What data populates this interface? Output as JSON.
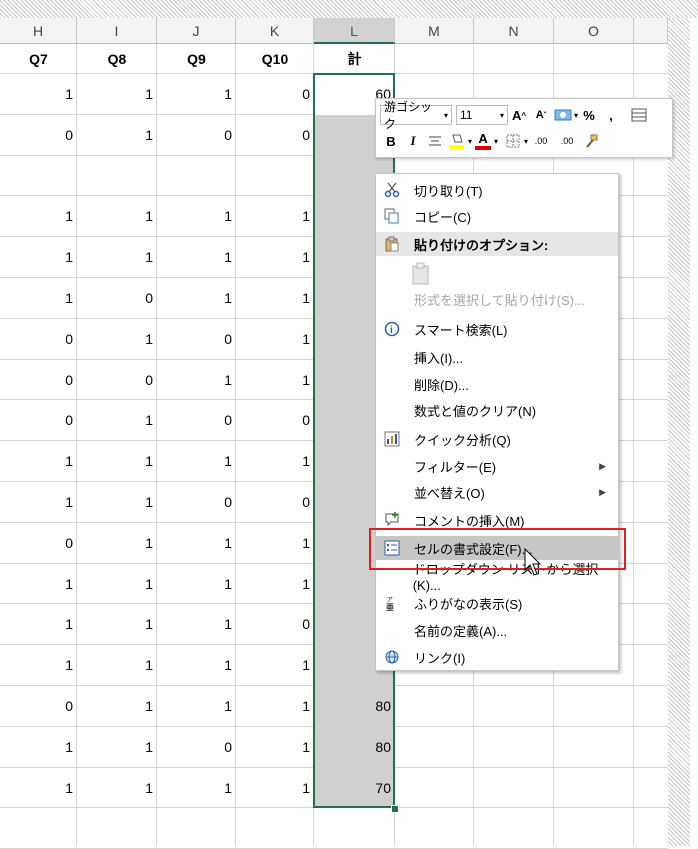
{
  "columns": [
    "H",
    "I",
    "J",
    "K",
    "L",
    "M",
    "N",
    "O"
  ],
  "header_row": [
    "Q7",
    "Q8",
    "Q9",
    "Q10",
    "計"
  ],
  "rows": [
    [
      "1",
      "1",
      "1",
      "0",
      "60"
    ],
    [
      "0",
      "1",
      "0",
      "0",
      ""
    ],
    [
      "",
      "",
      "",
      "",
      ""
    ],
    [
      "1",
      "1",
      "1",
      "1",
      ""
    ],
    [
      "1",
      "1",
      "1",
      "1",
      ""
    ],
    [
      "1",
      "0",
      "1",
      "1",
      ""
    ],
    [
      "0",
      "1",
      "0",
      "1",
      ""
    ],
    [
      "0",
      "0",
      "1",
      "1",
      ""
    ],
    [
      "0",
      "1",
      "0",
      "0",
      ""
    ],
    [
      "1",
      "1",
      "1",
      "1",
      ""
    ],
    [
      "1",
      "1",
      "0",
      "0",
      ""
    ],
    [
      "0",
      "1",
      "1",
      "1",
      ""
    ],
    [
      "1",
      "1",
      "1",
      "1",
      ""
    ],
    [
      "1",
      "1",
      "1",
      "0",
      ""
    ],
    [
      "1",
      "1",
      "1",
      "1",
      ""
    ],
    [
      "0",
      "1",
      "1",
      "1",
      "80"
    ],
    [
      "1",
      "1",
      "0",
      "1",
      "80"
    ],
    [
      "1",
      "1",
      "1",
      "1",
      "70"
    ]
  ],
  "mini_toolbar": {
    "font_name": "游ゴシック",
    "font_size": "11",
    "percent": "%",
    "comma": ",",
    "bold": "B",
    "italic": "I",
    "font_color_letter": "A",
    "increase_font": "A",
    "decrease_font": "A",
    "inc_decimal": ".00",
    "dec_decimal": ".00"
  },
  "context_menu": {
    "items": [
      {
        "label": "切り取り(T)",
        "icon": "scissors-icon"
      },
      {
        "label": "コピー(C)",
        "icon": "copy-icon"
      },
      {
        "label": "貼り付けのオプション:",
        "icon": "paste-icon",
        "section": true
      },
      {
        "label": "",
        "icon": "paste-clipboard-icon"
      },
      {
        "label": "形式を選択して貼り付け(S)...",
        "icon": "",
        "disabled": true
      },
      {
        "label": "スマート検索(L)",
        "icon": "smart-lookup-icon"
      },
      {
        "label": "挿入(I)...",
        "icon": ""
      },
      {
        "label": "削除(D)...",
        "icon": ""
      },
      {
        "label": "数式と値のクリア(N)",
        "icon": ""
      },
      {
        "label": "クイック分析(Q)",
        "icon": "quick-analysis-icon"
      },
      {
        "label": "フィルター(E)",
        "icon": "",
        "submenu": true
      },
      {
        "label": "並べ替え(O)",
        "icon": "",
        "submenu": true
      },
      {
        "label": "コメントの挿入(M)",
        "icon": "comment-icon"
      },
      {
        "label": "セルの書式設定(F)...",
        "icon": "format-cells-icon",
        "highlight": true
      },
      {
        "label": "ドロップダウン リストから選択(K)...",
        "icon": ""
      },
      {
        "label": "ふりがなの表示(S)",
        "icon": "furigana-icon"
      },
      {
        "label": "名前の定義(A)...",
        "icon": ""
      },
      {
        "label": "リンク(I)",
        "icon": "link-icon"
      }
    ]
  },
  "colors": {
    "accent": "#217346",
    "highlight_box": "#e02020",
    "selection": "#d0d0d0"
  }
}
